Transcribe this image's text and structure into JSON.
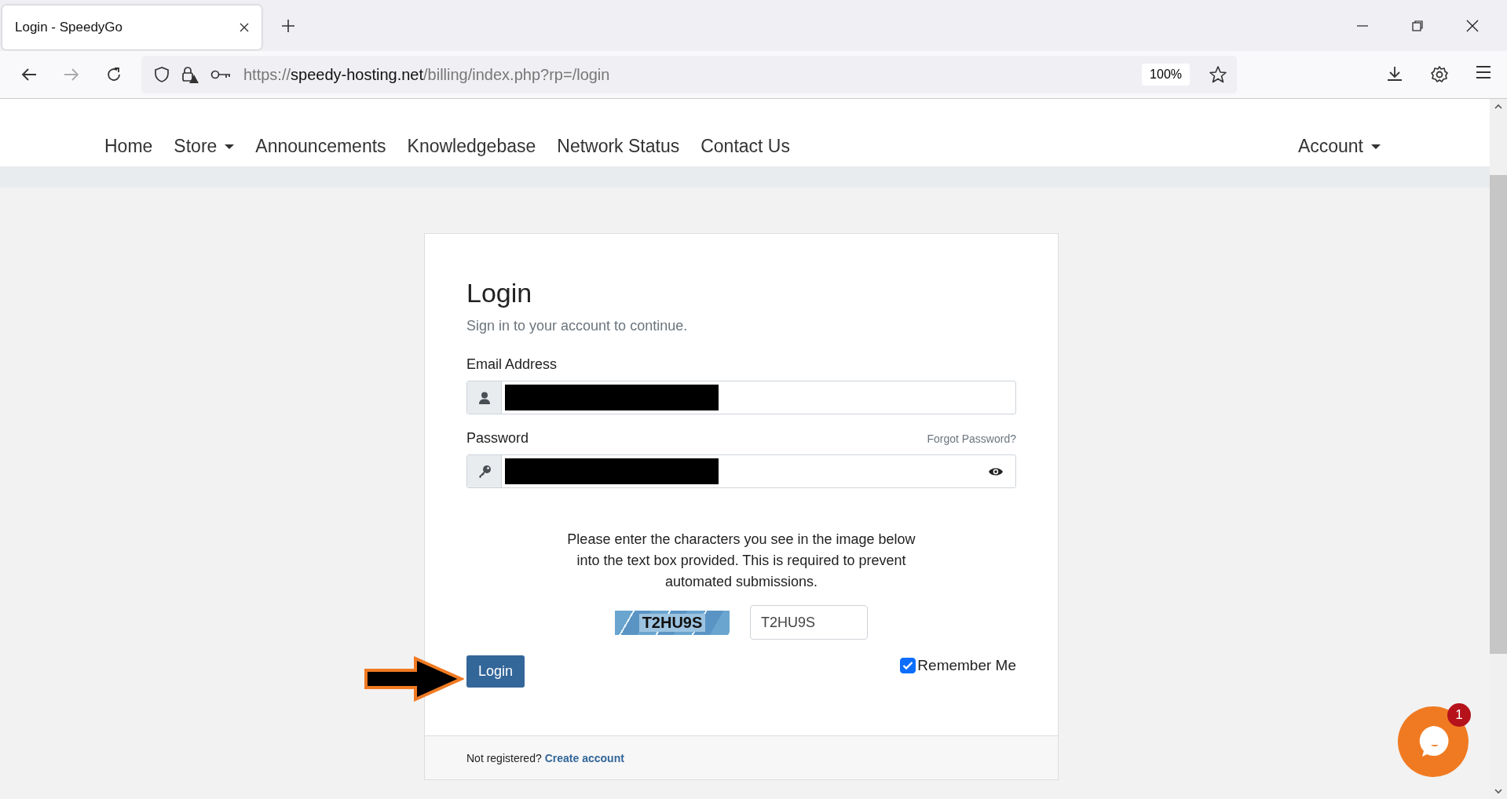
{
  "browser": {
    "tab_title": "Login - SpeedyGo",
    "url_scheme": "https://",
    "url_host": "speedy-hosting.net",
    "url_path": "/billing/index.php?rp=/login",
    "zoom": "100%"
  },
  "nav": {
    "items": [
      {
        "label": "Home",
        "dropdown": false
      },
      {
        "label": "Store",
        "dropdown": true
      },
      {
        "label": "Announcements",
        "dropdown": false
      },
      {
        "label": "Knowledgebase",
        "dropdown": false
      },
      {
        "label": "Network Status",
        "dropdown": false
      },
      {
        "label": "Contact Us",
        "dropdown": false
      }
    ],
    "account": {
      "label": "Account",
      "dropdown": true
    }
  },
  "login": {
    "title": "Login",
    "subtitle": "Sign in to your account to continue.",
    "email_label": "Email Address",
    "email_redacted": true,
    "password_label": "Password",
    "forgot_link": "Forgot Password?",
    "password_redacted": true,
    "captcha_text": "Please enter the characters you see in the image below into the text box provided. This is required to prevent automated submissions.",
    "captcha_image": "T2HU9S",
    "captcha_value": "T2HU9S",
    "button": "Login",
    "remember_label": "Remember Me",
    "remember_checked": true,
    "footer_text": "Not registered?",
    "footer_link": "Create account"
  },
  "chat": {
    "badge": "1"
  }
}
